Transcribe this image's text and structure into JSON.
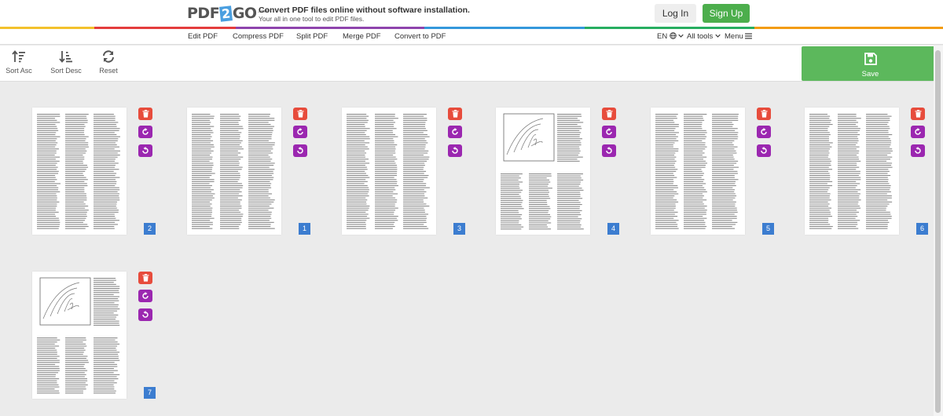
{
  "header": {
    "logo_pre": "PDF",
    "logo_two": "2",
    "logo_post": "GO",
    "logo_sup": ".com",
    "tagline": "Convert PDF files online without software installation.",
    "tagline_sub": "Your all in one tool to edit PDF files.",
    "login_label": "Log In",
    "signup_label": "Sign Up"
  },
  "nav": {
    "items": [
      {
        "label": "Edit PDF"
      },
      {
        "label": "Compress PDF"
      },
      {
        "label": "Split PDF"
      },
      {
        "label": "Merge PDF"
      },
      {
        "label": "Convert to PDF"
      }
    ],
    "language": "EN",
    "all_tools": "All tools",
    "menu": "Menu"
  },
  "toolbar": {
    "sort_asc": "Sort Asc",
    "sort_desc": "Sort Desc",
    "reset": "Reset",
    "save": "Save"
  },
  "pages": [
    {
      "number": "2",
      "kind": "text"
    },
    {
      "number": "1",
      "kind": "text"
    },
    {
      "number": "3",
      "kind": "text"
    },
    {
      "number": "4",
      "kind": "cartoon"
    },
    {
      "number": "5",
      "kind": "text"
    },
    {
      "number": "6",
      "kind": "text"
    },
    {
      "number": "7",
      "kind": "cartoon"
    }
  ],
  "colors": {
    "delete": "#e74c3c",
    "rotate": "#9b27b0",
    "page_number": "#3c7dd0",
    "save": "#5cb85c",
    "signup": "#4cae4c"
  }
}
